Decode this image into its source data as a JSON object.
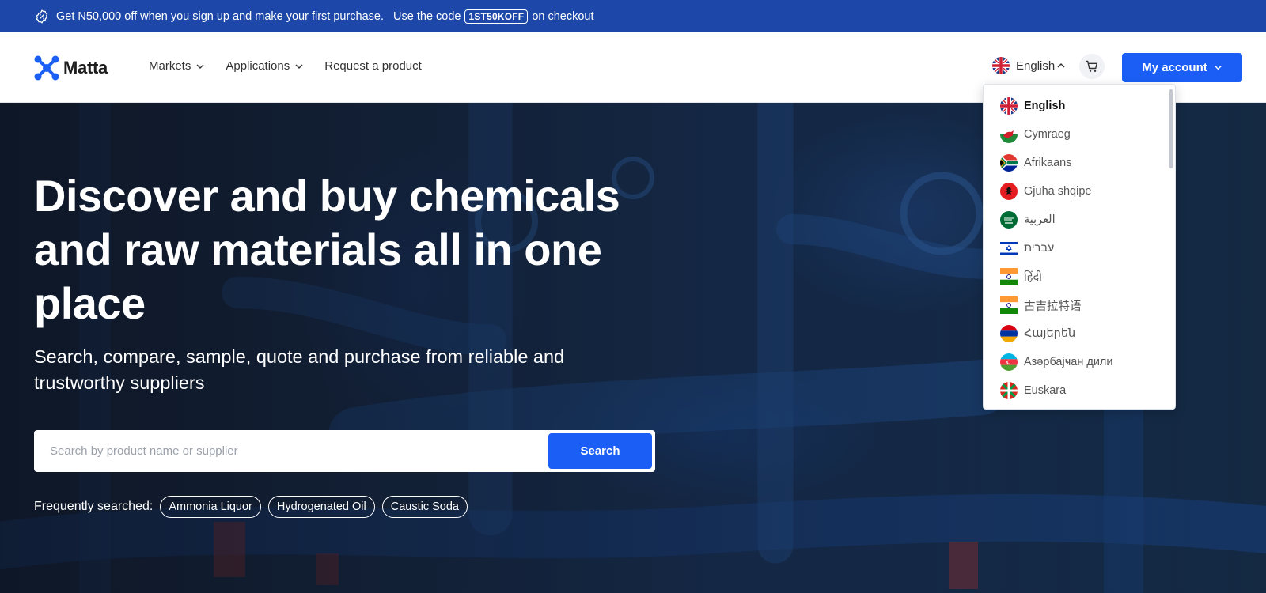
{
  "promo": {
    "text_before": "Get N50,000 off when you sign up and make your first purchase.",
    "text_code_lead": "Use the code",
    "code": "1ST50KOFF",
    "text_after": "on checkout"
  },
  "header": {
    "logo_text": "Matta",
    "nav": [
      {
        "label": "Markets",
        "has_dropdown": true
      },
      {
        "label": "Applications",
        "has_dropdown": true
      },
      {
        "label": "Request a product",
        "has_dropdown": false
      }
    ],
    "language": "English",
    "account_label": "My account"
  },
  "hero": {
    "title": "Discover and buy chemicals and raw materials all in one place",
    "subtitle": "Search, compare, sample, quote and purchase from reliable and trustworthy suppliers",
    "search": {
      "placeholder": "Search by product name or supplier",
      "value": "",
      "button_label": "Search"
    },
    "frequently_searched_label": "Frequently searched:",
    "frequent_searches": [
      "Ammonia Liquor",
      "Hydrogenated Oil",
      "Caustic Soda"
    ]
  },
  "language_menu": {
    "selected": "English",
    "items": [
      {
        "label": "English",
        "flag": "uk-flag-icon"
      },
      {
        "label": "Cymraeg",
        "flag": "wales-flag-icon"
      },
      {
        "label": "Afrikaans",
        "flag": "south-africa-flag-icon"
      },
      {
        "label": "Gjuha shqipe",
        "flag": "albania-flag-icon"
      },
      {
        "label": "العربية",
        "flag": "saudi-flag-icon"
      },
      {
        "label": "עברית",
        "flag": "israel-flag-icon"
      },
      {
        "label": "हिंदी",
        "flag": "india-flag-icon"
      },
      {
        "label": "古吉拉特语",
        "flag": "india-flag-icon"
      },
      {
        "label": "Հայերեն",
        "flag": "armenia-flag-icon"
      },
      {
        "label": "Азәрбајҹан дили",
        "flag": "azerbaijan-flag-icon"
      },
      {
        "label": "Euskara",
        "flag": "basque-flag-icon"
      }
    ]
  },
  "colors": {
    "promo_bg": "#1d47a8",
    "primary": "#1a5ef5",
    "hero_text": "#ffffff"
  }
}
